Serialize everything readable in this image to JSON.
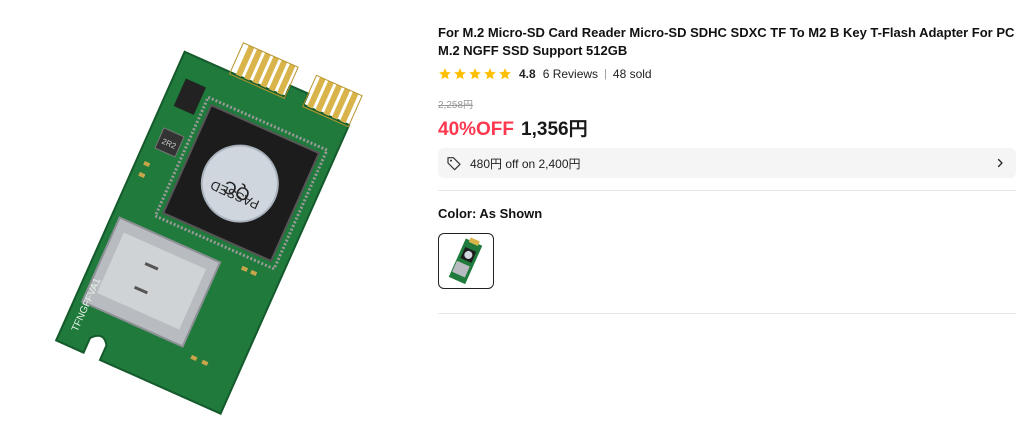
{
  "product": {
    "title": "For M.2 Micro-SD Card Reader Micro-SD SDHC SDXC TF To M2 B Key T-Flash Adapter For PC M.2 NGFF SSD Support 512GB",
    "rating": "4.8",
    "reviews": "6 Reviews",
    "separator": "|",
    "sold": "48 sold",
    "stars": 5
  },
  "image": {
    "chip_text_1": "QC",
    "chip_text_2": "PASSED",
    "board_label": "TFNGFFVA1",
    "inductor_label": "2R2"
  },
  "pricing": {
    "original": "2,258円",
    "discount": "40%OFF",
    "current": "1,356円"
  },
  "coupon": {
    "text": "480円 off on 2,400円"
  },
  "variant": {
    "color_label": "Color: As Shown"
  },
  "colors": {
    "accent": "#fd384f",
    "star": "#ffbf00",
    "pcb": "#1f7a3c"
  },
  "icons": {
    "coupon": "tag-icon",
    "chevron": "chevron-right-icon",
    "star": "star-icon"
  }
}
